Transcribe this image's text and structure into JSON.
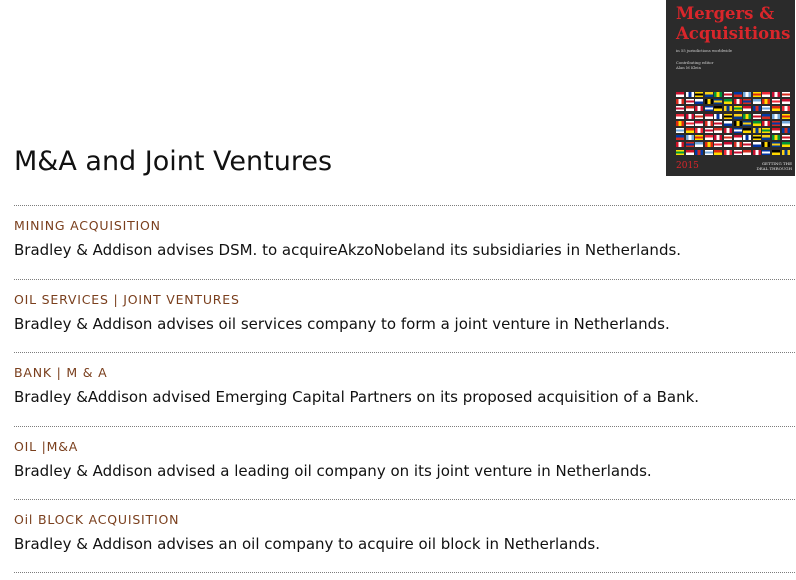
{
  "cover": {
    "title_line1": "Mergers &",
    "title_line2": "Acquisitions",
    "sub1": "in 55 jurisdictions worldwide",
    "sub2": "Contributing editor",
    "sub3": "Alan M Klein",
    "year": "2015",
    "publisher_line1": "GETTING THE",
    "publisher_line2": "DEAL THROUGH",
    "flag_colors": [
      [
        "#c8102e",
        "#ffffff"
      ],
      [
        "#75aadb",
        "#ffffff"
      ],
      [
        "#000000",
        "#ffd700"
      ],
      [
        "#ed2939",
        "#ffffff"
      ],
      [
        "#009739",
        "#fedd00"
      ],
      [
        "#d52b1e",
        "#ffffff"
      ],
      [
        "#0039a6",
        "#d52b1e"
      ],
      [
        "#ffffff",
        "#0033a0"
      ],
      [
        "#de2910",
        "#ffde00"
      ],
      [
        "#fcd116",
        "#003893"
      ],
      [
        "#c60c30",
        "#ffffff"
      ],
      [
        "#ce1126",
        "#ffffff"
      ]
    ]
  },
  "page": {
    "title": "M&A and Joint Ventures"
  },
  "deals": [
    {
      "category": "MINING ACQUISITION",
      "description": "Bradley & Addison advises DSM. to acquireAkzoNobeland its subsidiaries in Netherlands."
    },
    {
      "category": "OIL SERVICES | JOINT VENTURES",
      "description": "Bradley & Addison advises oil services company to form a joint venture in Netherlands."
    },
    {
      "category": "BANK | M & A",
      "description": "Bradley &Addison advised Emerging Capital Partners on its proposed acquisition of a Bank."
    },
    {
      "category": "OIL |M&A",
      "description": "Bradley & Addison advised a leading oil company on its joint venture in Netherlands."
    },
    {
      "category": "Oil BLOCK ACQUISITION",
      "description": "Bradley & Addison advises an oil company to acquire oil block in Netherlands."
    }
  ]
}
